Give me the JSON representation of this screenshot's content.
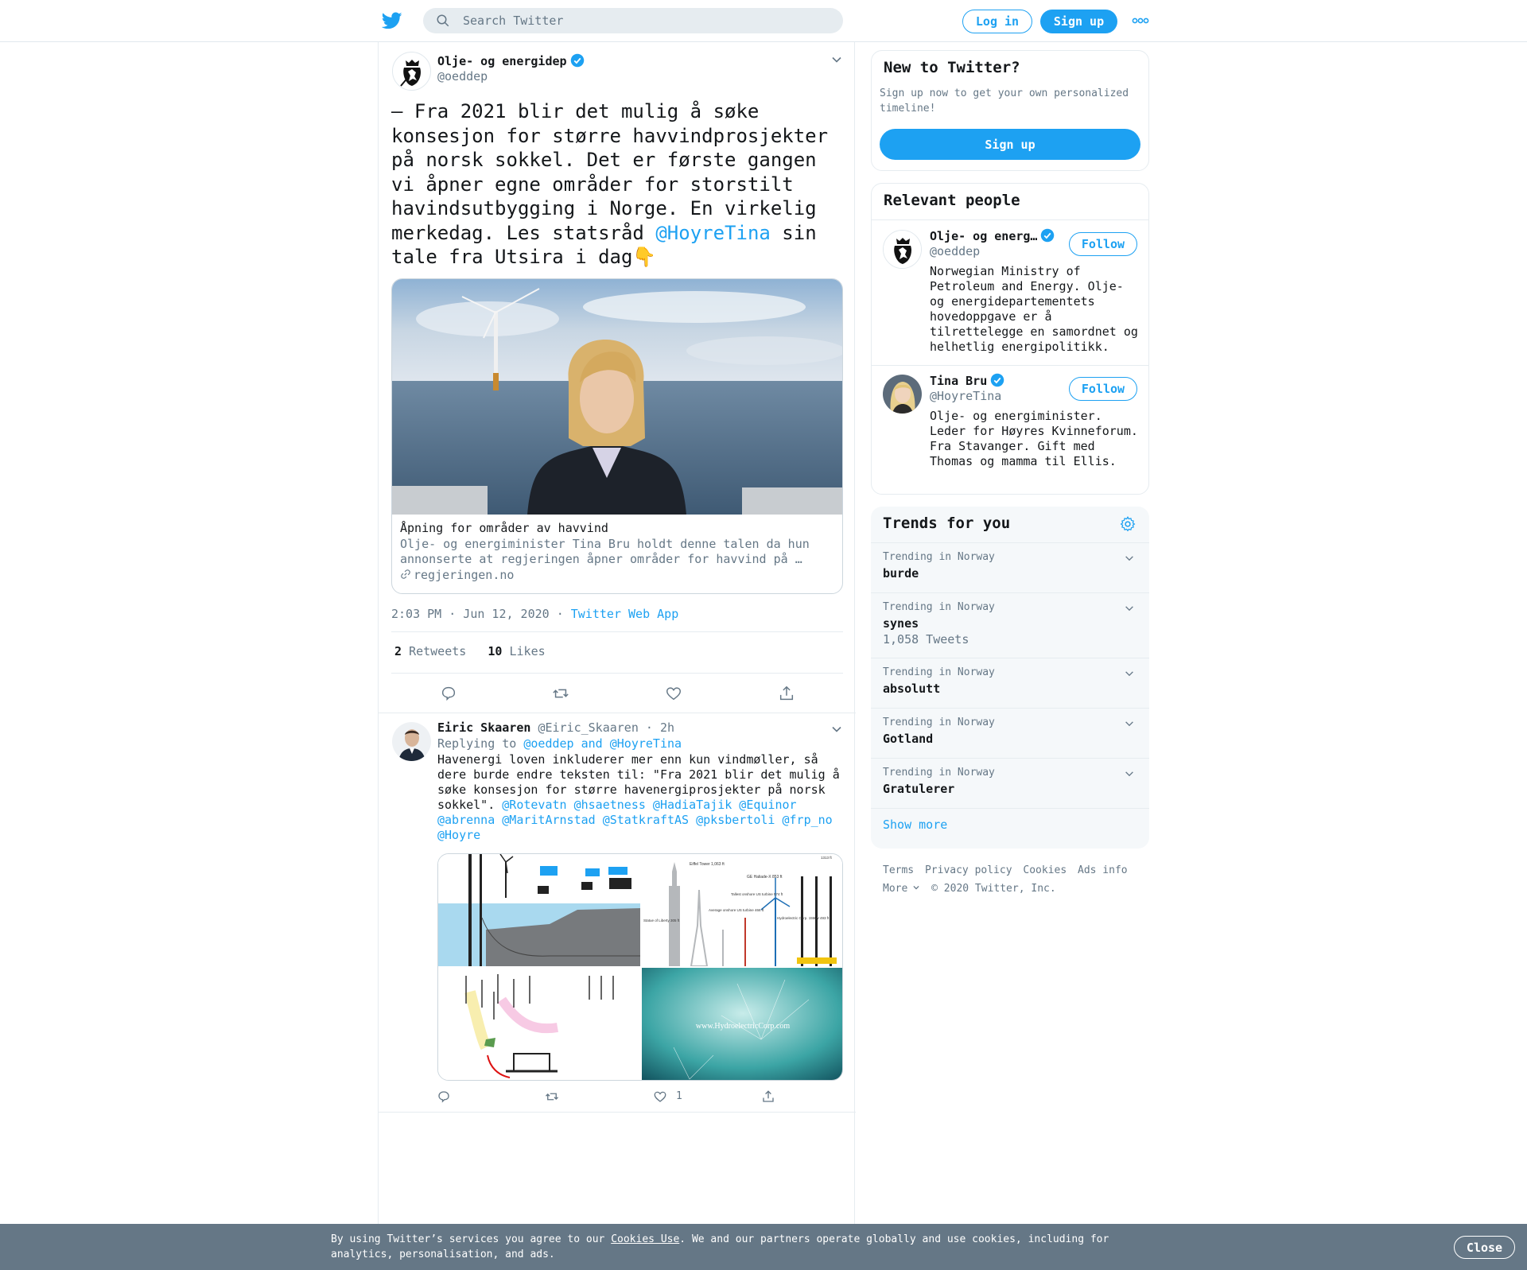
{
  "header": {
    "search_placeholder": "Search Twitter",
    "login_label": "Log in",
    "signup_label": "Sign up",
    "brand_color": "#1da1f2"
  },
  "tweet": {
    "author_name": "Olje- og energidep",
    "author_handle": "@oeddep",
    "text_before": "— Fra 2021 blir det mulig å søke konsesjon for større havvindprosjekter på norsk sokkel. Det er første gangen vi åpner egne områder for storstilt havindsutbygging i Norge. En virkelig merkedag. Les statsråd ",
    "text_mention": "@HoyreTina",
    "text_after": " sin tale fra Utsira i dag👇",
    "card": {
      "title": "Åpning for områder av havvind",
      "description": "Olje- og energiminister Tina Bru holdt denne talen da hun annonserte at regjeringen åpner områder for havvind på …",
      "domain": "regjeringen.no"
    },
    "time": "2:03 PM · Jun 12, 2020",
    "separator": "·",
    "source": "Twitter Web App",
    "retweets_count": "2",
    "retweets_label": "Retweets",
    "likes_count": "10",
    "likes_label": "Likes"
  },
  "reply": {
    "author_name": "Eiric Skaaren",
    "author_handle": "@Eiric_Skaaren",
    "time": "· 2h",
    "replying_to_label": "Replying to",
    "replying_to_users": "@oeddep and @HoyreTina",
    "text_plain": "Havenergi loven inkluderer mer enn kun vindmøller, så dere burde endre teksten til: \"Fra 2021 blir det mulig å søke konsesjon for større havenergiprosjekter på norsk sokkel\". ",
    "text_mentions": "@Rotevatn @hsaetness @HadiaTajik @Equinor @abrenna @MaritArnstad @StatkraftAS @pksbertoli @frp_no @Hoyre",
    "like_count": "1",
    "media": {
      "chart_labels": [
        "Eiffel Tower 1,063 ft",
        "GE Haliade-X 853 ft",
        "Tallest onshore US turbine 574 ft",
        "Average onshore US turbine 466 ft",
        "Statue of Liberty 305 ft",
        "Hydroelectric Corp. 15MW 493 ft",
        "1313 ft"
      ],
      "watermark": "www.HydroelectricCorp.com"
    }
  },
  "sidebar": {
    "new_title": "New to Twitter?",
    "new_text": "Sign up now to get your own personalized timeline!",
    "new_signup": "Sign up",
    "people_title": "Relevant people",
    "people": [
      {
        "name": "Olje- og energ…",
        "handle": "@oeddep",
        "bio": "Norwegian Ministry of Petroleum and Energy. Olje- og energidepartementets hovedoppgave er å tilrettelegge en samordnet og helhetlig energipolitikk.",
        "follow": "Follow"
      },
      {
        "name": "Tina Bru",
        "handle": "@HoyreTina",
        "bio": "Olje- og energiminister. Leder for Høyres Kvinneforum. Fra Stavanger. Gift med Thomas og mamma til Ellis.",
        "follow": "Follow"
      }
    ],
    "trends_title": "Trends for you",
    "trends": [
      {
        "context": "Trending in Norway",
        "name": "burde",
        "count": ""
      },
      {
        "context": "Trending in Norway",
        "name": "synes",
        "count": "1,058 Tweets"
      },
      {
        "context": "Trending in Norway",
        "name": "absolutt",
        "count": ""
      },
      {
        "context": "Trending in Norway",
        "name": "Gotland",
        "count": ""
      },
      {
        "context": "Trending in Norway",
        "name": "Gratulerer",
        "count": ""
      }
    ],
    "show_more": "Show more",
    "footer": {
      "terms": "Terms",
      "privacy": "Privacy policy",
      "cookies": "Cookies",
      "ads": "Ads info",
      "more": "More",
      "copyright": "© 2020 Twitter, Inc."
    }
  },
  "cookie_bar": {
    "text_before": "By using Twitter’s services you agree to our ",
    "link": "Cookies Use",
    "text_after": ". We and our partners operate globally and use cookies, including for analytics, personalisation, and ads.",
    "close": "Close"
  }
}
